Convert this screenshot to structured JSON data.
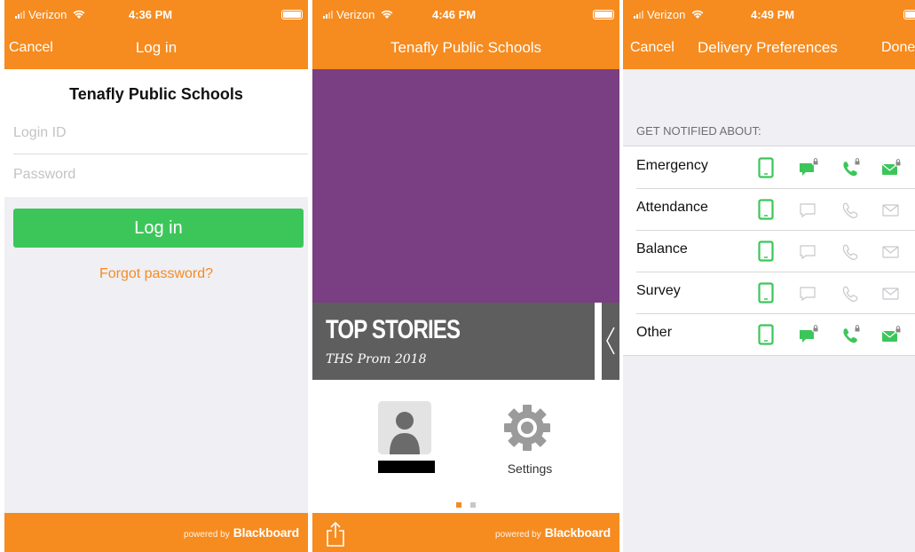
{
  "colors": {
    "orange": "#f68b1f",
    "green": "#3cc65a",
    "purple": "#7a3e82",
    "banner_gray": "#5e5e5e",
    "inactive_icon": "#c7c7cc"
  },
  "screen1": {
    "status": {
      "carrier": "Verizon",
      "time": "4:36 PM"
    },
    "nav": {
      "cancel": "Cancel",
      "title": "Log in"
    },
    "org_title": "Tenafly Public Schools",
    "login_id_placeholder": "Login ID",
    "password_placeholder": "Password",
    "login_button": "Log in",
    "forgot_link": "Forgot password?",
    "footer": {
      "powered_by": "powered by",
      "brand": "Blackboard"
    }
  },
  "screen2": {
    "status": {
      "carrier": "Verizon",
      "time": "4:46 PM"
    },
    "nav": {
      "title": "Tenafly Public Schools"
    },
    "top_stories": {
      "title": "TOP STORIES",
      "subtitle": "THS Prom 2018"
    },
    "settings_label": "Settings",
    "page_indicator": {
      "pages": 2,
      "current": 1
    },
    "footer": {
      "powered_by": "powered by",
      "brand": "Blackboard"
    },
    "icons": {
      "share": "share-icon",
      "profile": "person-icon",
      "settings": "gear-icon"
    }
  },
  "screen3": {
    "status": {
      "carrier": "Verizon",
      "time": "4:49 PM"
    },
    "nav": {
      "cancel": "Cancel",
      "title": "Delivery Preferences",
      "done": "Done"
    },
    "section_header": "GET NOTIFIED ABOUT:",
    "channels": [
      "app-phone",
      "sms",
      "call",
      "email"
    ],
    "rows": [
      {
        "label": "Emergency",
        "app": true,
        "sms": true,
        "call": true,
        "email": true,
        "locked": true
      },
      {
        "label": "Attendance",
        "app": true,
        "sms": false,
        "call": false,
        "email": false,
        "locked": false
      },
      {
        "label": "Balance",
        "app": true,
        "sms": false,
        "call": false,
        "email": false,
        "locked": false
      },
      {
        "label": "Survey",
        "app": true,
        "sms": false,
        "call": false,
        "email": false,
        "locked": false
      },
      {
        "label": "Other",
        "app": true,
        "sms": true,
        "call": true,
        "email": true,
        "locked": true
      }
    ]
  }
}
